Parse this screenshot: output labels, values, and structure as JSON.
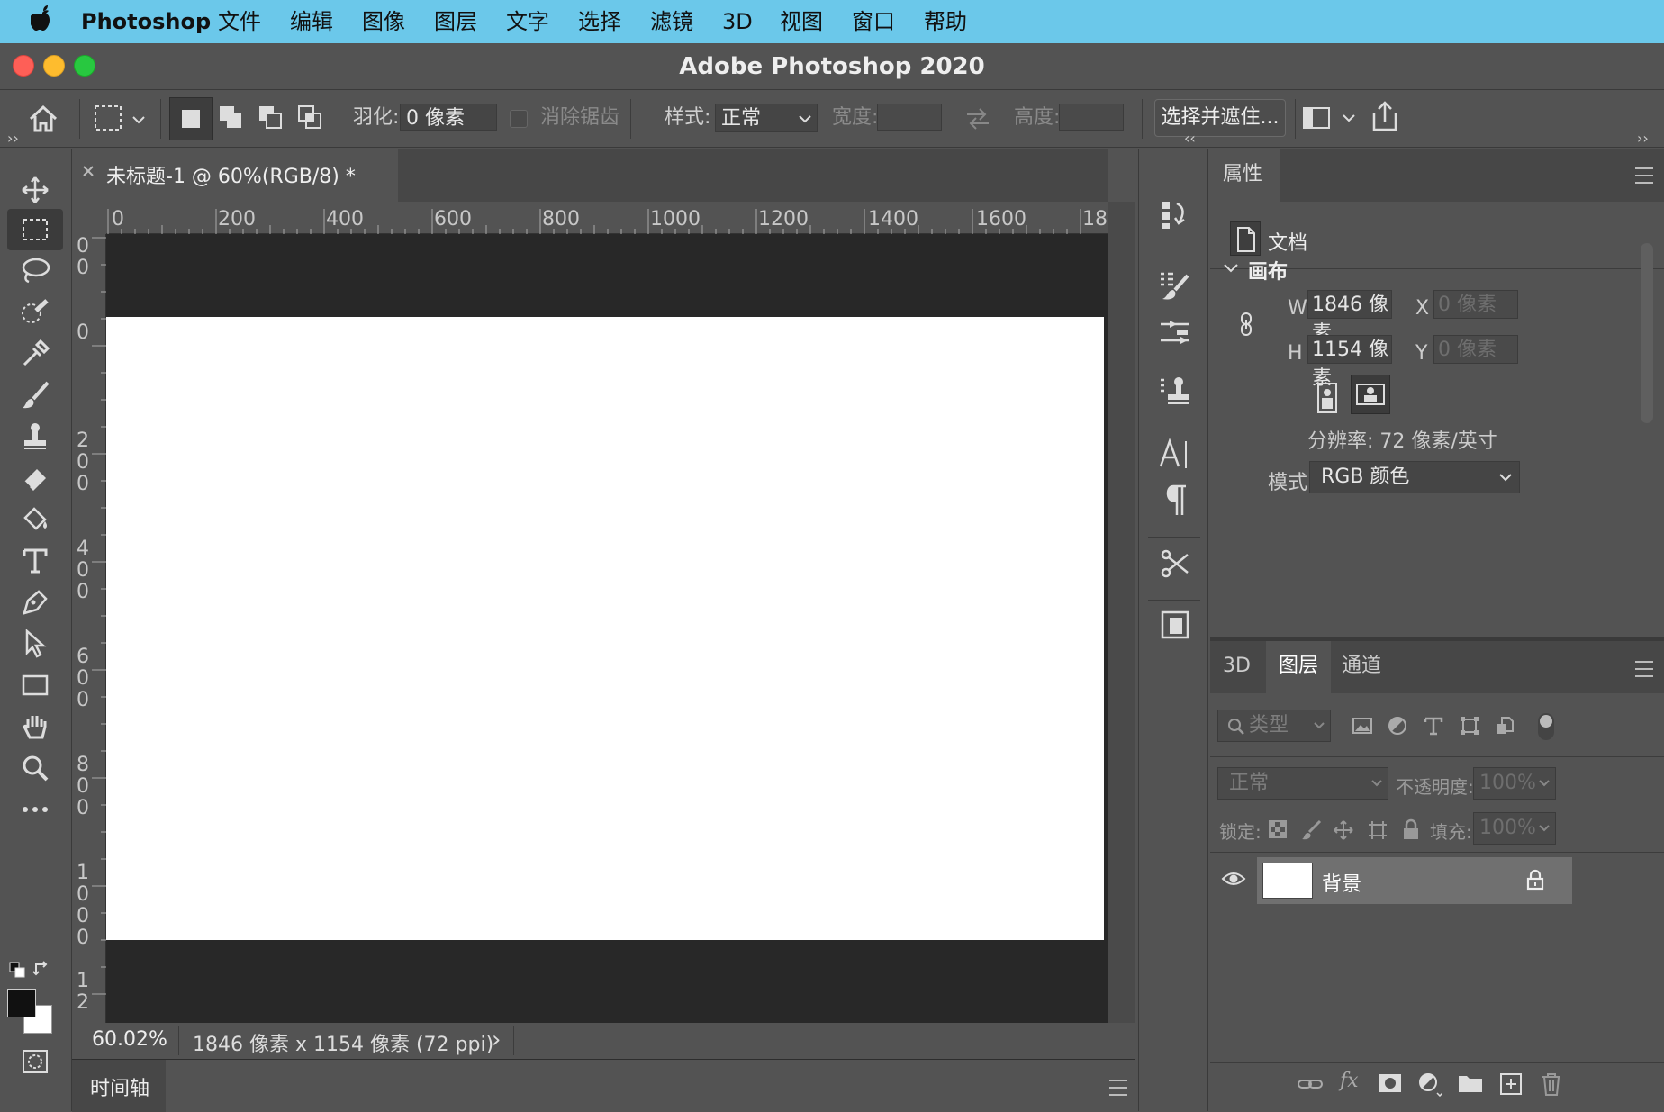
{
  "menubar": {
    "app_name": "Photoshop",
    "items": [
      "文件",
      "编辑",
      "图像",
      "图层",
      "文字",
      "选择",
      "滤镜",
      "3D",
      "视图",
      "窗口",
      "帮助"
    ]
  },
  "window": {
    "title": "Adobe Photoshop 2020"
  },
  "options": {
    "feather_label": "羽化:",
    "feather_value": "0 像素",
    "antialias_label": "消除锯齿",
    "style_label": "样式:",
    "style_value": "正常",
    "width_label": "宽度:",
    "height_label": "高度:",
    "select_mask_button": "选择并遮住..."
  },
  "document": {
    "tab_title": "未标题-1 @ 60%(RGB/8) *",
    "ruler_h": [
      "0",
      "200",
      "400",
      "600",
      "800",
      "1000",
      "1200",
      "1400",
      "1600",
      "18"
    ],
    "ruler_v": [
      [
        "0",
        "0"
      ],
      [
        "0"
      ],
      [
        "2",
        "0",
        "0"
      ],
      [
        "4",
        "0",
        "0"
      ],
      [
        "6",
        "0",
        "0"
      ],
      [
        "8",
        "0",
        "0"
      ],
      [
        "1",
        "0",
        "0",
        "0"
      ],
      [
        "1",
        "2"
      ]
    ]
  },
  "status": {
    "zoom": "60.02%",
    "info": "1846 像素 x 1154 像素 (72 ppi)",
    "arrow": "›"
  },
  "timeline": {
    "label": "时间轴"
  },
  "properties": {
    "tab": "属性",
    "doc_label": "文档",
    "canvas_section": "画布",
    "w_label": "W",
    "w_value": "1846 像素",
    "h_label": "H",
    "h_value": "1154 像素",
    "x_label": "X",
    "x_placeholder": "0 像素",
    "y_label": "Y",
    "y_placeholder": "0 像素",
    "resolution": "分辨率: 72 像素/英寸",
    "mode_label": "模式",
    "mode_value": "RGB 颜色"
  },
  "layers_panel": {
    "tabs": [
      "3D",
      "图层",
      "通道"
    ],
    "active_tab": "图层",
    "filter_placeholder": "类型",
    "blend_mode": "正常",
    "opacity_label": "不透明度:",
    "opacity_value": "100%",
    "lock_label": "锁定:",
    "fill_label": "填充:",
    "fill_value": "100%",
    "layers": [
      {
        "name": "背景"
      }
    ]
  },
  "colors": {
    "menubar_bg": "#6bc8ea",
    "ui_bg": "#535353",
    "pasteboard": "#282828",
    "canvas": "#ffffff",
    "foreground_color": "#111111",
    "background_color": "#ffffff"
  },
  "icons": [
    "apple-icon",
    "home-icon",
    "marquee-icon",
    "move-icon",
    "lasso-icon",
    "quick-select-icon",
    "eyedropper-icon",
    "brush-icon",
    "stamp-icon",
    "eraser-icon",
    "paint-bucket-icon",
    "type-icon",
    "pen-icon",
    "path-select-icon",
    "rectangle-icon",
    "hand-icon",
    "zoom-icon",
    "more-icon",
    "swap-icon",
    "quick-mask-icon",
    "history-icon",
    "brush-settings-icon",
    "adjust-icon",
    "clone-source-icon",
    "character-icon",
    "paragraph-icon",
    "tool-presets-icon",
    "swatches-icon",
    "document-icon",
    "link-icon",
    "eye-icon",
    "lock-icon",
    "fx-icon",
    "mask-icon",
    "folder-icon",
    "new-layer-icon",
    "trash-icon"
  ]
}
